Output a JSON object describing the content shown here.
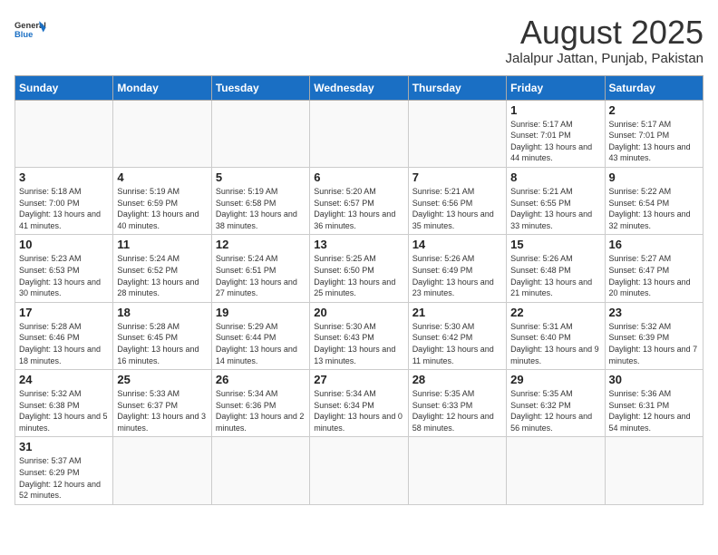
{
  "header": {
    "logo_general": "General",
    "logo_blue": "Blue",
    "title": "August 2025",
    "subtitle": "Jalalpur Jattan, Punjab, Pakistan"
  },
  "weekdays": [
    "Sunday",
    "Monday",
    "Tuesday",
    "Wednesday",
    "Thursday",
    "Friday",
    "Saturday"
  ],
  "weeks": [
    [
      {
        "day": "",
        "info": ""
      },
      {
        "day": "",
        "info": ""
      },
      {
        "day": "",
        "info": ""
      },
      {
        "day": "",
        "info": ""
      },
      {
        "day": "",
        "info": ""
      },
      {
        "day": "1",
        "info": "Sunrise: 5:17 AM\nSunset: 7:01 PM\nDaylight: 13 hours and 44 minutes."
      },
      {
        "day": "2",
        "info": "Sunrise: 5:17 AM\nSunset: 7:01 PM\nDaylight: 13 hours and 43 minutes."
      }
    ],
    [
      {
        "day": "3",
        "info": "Sunrise: 5:18 AM\nSunset: 7:00 PM\nDaylight: 13 hours and 41 minutes."
      },
      {
        "day": "4",
        "info": "Sunrise: 5:19 AM\nSunset: 6:59 PM\nDaylight: 13 hours and 40 minutes."
      },
      {
        "day": "5",
        "info": "Sunrise: 5:19 AM\nSunset: 6:58 PM\nDaylight: 13 hours and 38 minutes."
      },
      {
        "day": "6",
        "info": "Sunrise: 5:20 AM\nSunset: 6:57 PM\nDaylight: 13 hours and 36 minutes."
      },
      {
        "day": "7",
        "info": "Sunrise: 5:21 AM\nSunset: 6:56 PM\nDaylight: 13 hours and 35 minutes."
      },
      {
        "day": "8",
        "info": "Sunrise: 5:21 AM\nSunset: 6:55 PM\nDaylight: 13 hours and 33 minutes."
      },
      {
        "day": "9",
        "info": "Sunrise: 5:22 AM\nSunset: 6:54 PM\nDaylight: 13 hours and 32 minutes."
      }
    ],
    [
      {
        "day": "10",
        "info": "Sunrise: 5:23 AM\nSunset: 6:53 PM\nDaylight: 13 hours and 30 minutes."
      },
      {
        "day": "11",
        "info": "Sunrise: 5:24 AM\nSunset: 6:52 PM\nDaylight: 13 hours and 28 minutes."
      },
      {
        "day": "12",
        "info": "Sunrise: 5:24 AM\nSunset: 6:51 PM\nDaylight: 13 hours and 27 minutes."
      },
      {
        "day": "13",
        "info": "Sunrise: 5:25 AM\nSunset: 6:50 PM\nDaylight: 13 hours and 25 minutes."
      },
      {
        "day": "14",
        "info": "Sunrise: 5:26 AM\nSunset: 6:49 PM\nDaylight: 13 hours and 23 minutes."
      },
      {
        "day": "15",
        "info": "Sunrise: 5:26 AM\nSunset: 6:48 PM\nDaylight: 13 hours and 21 minutes."
      },
      {
        "day": "16",
        "info": "Sunrise: 5:27 AM\nSunset: 6:47 PM\nDaylight: 13 hours and 20 minutes."
      }
    ],
    [
      {
        "day": "17",
        "info": "Sunrise: 5:28 AM\nSunset: 6:46 PM\nDaylight: 13 hours and 18 minutes."
      },
      {
        "day": "18",
        "info": "Sunrise: 5:28 AM\nSunset: 6:45 PM\nDaylight: 13 hours and 16 minutes."
      },
      {
        "day": "19",
        "info": "Sunrise: 5:29 AM\nSunset: 6:44 PM\nDaylight: 13 hours and 14 minutes."
      },
      {
        "day": "20",
        "info": "Sunrise: 5:30 AM\nSunset: 6:43 PM\nDaylight: 13 hours and 13 minutes."
      },
      {
        "day": "21",
        "info": "Sunrise: 5:30 AM\nSunset: 6:42 PM\nDaylight: 13 hours and 11 minutes."
      },
      {
        "day": "22",
        "info": "Sunrise: 5:31 AM\nSunset: 6:40 PM\nDaylight: 13 hours and 9 minutes."
      },
      {
        "day": "23",
        "info": "Sunrise: 5:32 AM\nSunset: 6:39 PM\nDaylight: 13 hours and 7 minutes."
      }
    ],
    [
      {
        "day": "24",
        "info": "Sunrise: 5:32 AM\nSunset: 6:38 PM\nDaylight: 13 hours and 5 minutes."
      },
      {
        "day": "25",
        "info": "Sunrise: 5:33 AM\nSunset: 6:37 PM\nDaylight: 13 hours and 3 minutes."
      },
      {
        "day": "26",
        "info": "Sunrise: 5:34 AM\nSunset: 6:36 PM\nDaylight: 13 hours and 2 minutes."
      },
      {
        "day": "27",
        "info": "Sunrise: 5:34 AM\nSunset: 6:34 PM\nDaylight: 13 hours and 0 minutes."
      },
      {
        "day": "28",
        "info": "Sunrise: 5:35 AM\nSunset: 6:33 PM\nDaylight: 12 hours and 58 minutes."
      },
      {
        "day": "29",
        "info": "Sunrise: 5:35 AM\nSunset: 6:32 PM\nDaylight: 12 hours and 56 minutes."
      },
      {
        "day": "30",
        "info": "Sunrise: 5:36 AM\nSunset: 6:31 PM\nDaylight: 12 hours and 54 minutes."
      }
    ],
    [
      {
        "day": "31",
        "info": "Sunrise: 5:37 AM\nSunset: 6:29 PM\nDaylight: 12 hours and 52 minutes."
      },
      {
        "day": "",
        "info": ""
      },
      {
        "day": "",
        "info": ""
      },
      {
        "day": "",
        "info": ""
      },
      {
        "day": "",
        "info": ""
      },
      {
        "day": "",
        "info": ""
      },
      {
        "day": "",
        "info": ""
      }
    ]
  ]
}
